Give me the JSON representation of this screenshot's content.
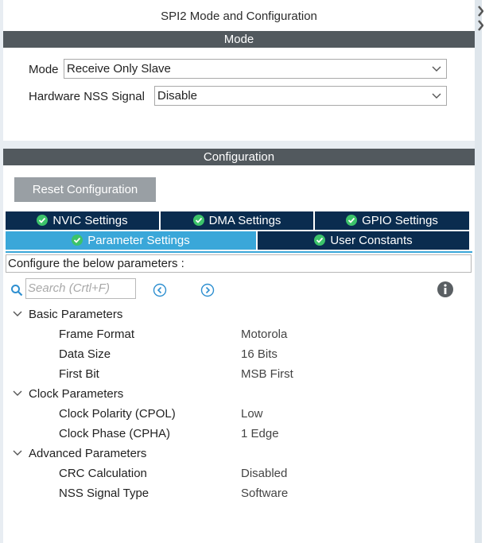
{
  "window": {
    "title": "SPI2 Mode and Configuration"
  },
  "mode_section": {
    "header": "Mode",
    "fields": [
      {
        "label": "Mode",
        "value": "Receive Only Slave"
      },
      {
        "label": "Hardware NSS Signal",
        "value": "Disable"
      }
    ]
  },
  "config_section": {
    "header": "Configuration",
    "reset_label": "Reset Configuration",
    "tabs_row1": [
      "NVIC Settings",
      "DMA Settings",
      "GPIO Settings"
    ],
    "tabs_row2": [
      "Parameter Settings",
      "User Constants"
    ],
    "active_tab": "Parameter Settings",
    "description": "Configure the below parameters :",
    "search_placeholder": "Search (Crtl+F)"
  },
  "parameters": {
    "groups": [
      {
        "name": "Basic Parameters",
        "items": [
          {
            "name": "Frame Format",
            "value": "Motorola"
          },
          {
            "name": "Data Size",
            "value": "16 Bits"
          },
          {
            "name": "First Bit",
            "value": "MSB First"
          }
        ]
      },
      {
        "name": "Clock Parameters",
        "items": [
          {
            "name": "Clock Polarity (CPOL)",
            "value": "Low"
          },
          {
            "name": "Clock Phase (CPHA)",
            "value": "1 Edge"
          }
        ]
      },
      {
        "name": "Advanced Parameters",
        "items": [
          {
            "name": "CRC Calculation",
            "value": "Disabled"
          },
          {
            "name": "NSS Signal Type",
            "value": "Software"
          }
        ]
      }
    ]
  },
  "colors": {
    "section_bar": "#52595e",
    "tab_dark": "#0a2c4f",
    "tab_active": "#3aa7d9",
    "reset_button": "#999fa4"
  },
  "icons": [
    "check-circle-icon",
    "chevron-down-icon",
    "search-icon",
    "previous-icon",
    "next-icon",
    "info-icon",
    "collapse-icon"
  ]
}
